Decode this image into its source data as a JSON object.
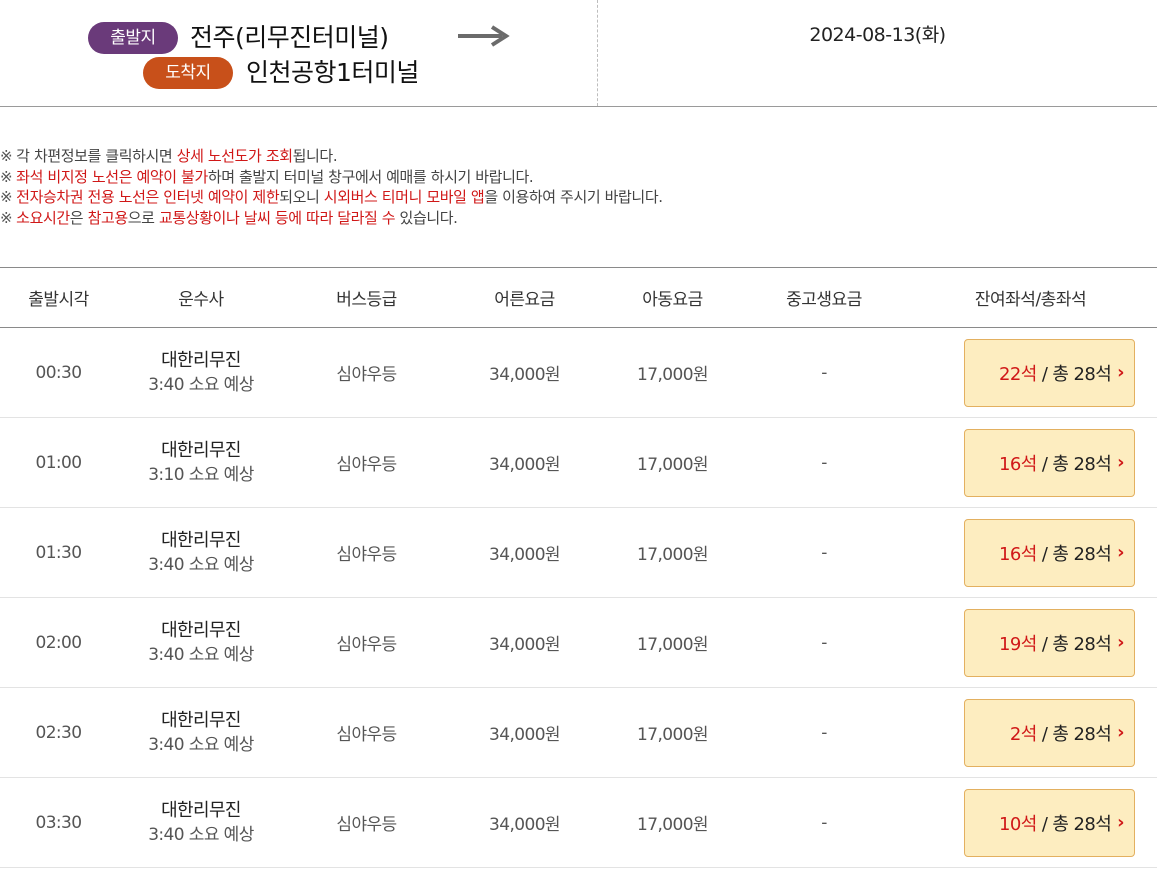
{
  "route": {
    "departure_badge": "출발지",
    "departure_terminal": "전주(리무진터미널)",
    "arrival_badge": "도착지",
    "arrival_terminal": "인천공항1터미널",
    "date": "2024-08-13(화)"
  },
  "notices": [
    [
      {
        "t": "각 차편정보를 클릭하시면 ",
        "hl": false
      },
      {
        "t": "상세 노선도가 조회",
        "hl": true
      },
      {
        "t": "됩니다.",
        "hl": false
      }
    ],
    [
      {
        "t": "좌석 비지정 노선은 예약이 불가",
        "hl": true
      },
      {
        "t": "하며 출발지 터미널 창구에서 예매를 하시기 바랍니다.",
        "hl": false
      }
    ],
    [
      {
        "t": "전자승차권 전용 노선은 인터넷 예약이 제한",
        "hl": true
      },
      {
        "t": "되오니 ",
        "hl": false
      },
      {
        "t": "시외버스 티머니 모바일 앱",
        "hl": true
      },
      {
        "t": "을 이용하여 주시기 바랍니다.",
        "hl": false
      }
    ],
    [
      {
        "t": "소요시간",
        "hl": true
      },
      {
        "t": "은 ",
        "hl": false
      },
      {
        "t": "참고용",
        "hl": true
      },
      {
        "t": "으로 ",
        "hl": false
      },
      {
        "t": "교통상황이나 날씨 등에 따라 달라질 수",
        "hl": true
      },
      {
        "t": " 있습니다.",
        "hl": false
      }
    ]
  ],
  "notice_mark": "※",
  "table": {
    "headers": [
      "출발시각",
      "운수사",
      "버스등급",
      "어른요금",
      "아동요금",
      "중고생요금",
      "잔여좌석/총좌석"
    ],
    "total_prefix": "/ 총",
    "rows": [
      {
        "time": "00:30",
        "company": "대한리무진",
        "duration": "3:40 소요 예상",
        "grade": "심야우등",
        "adult": "34,000원",
        "child": "17,000원",
        "student": "-",
        "remaining": "22석",
        "total": "28석"
      },
      {
        "time": "01:00",
        "company": "대한리무진",
        "duration": "3:10 소요 예상",
        "grade": "심야우등",
        "adult": "34,000원",
        "child": "17,000원",
        "student": "-",
        "remaining": "16석",
        "total": "28석"
      },
      {
        "time": "01:30",
        "company": "대한리무진",
        "duration": "3:40 소요 예상",
        "grade": "심야우등",
        "adult": "34,000원",
        "child": "17,000원",
        "student": "-",
        "remaining": "16석",
        "total": "28석"
      },
      {
        "time": "02:00",
        "company": "대한리무진",
        "duration": "3:40 소요 예상",
        "grade": "심야우등",
        "adult": "34,000원",
        "child": "17,000원",
        "student": "-",
        "remaining": "19석",
        "total": "28석"
      },
      {
        "time": "02:30",
        "company": "대한리무진",
        "duration": "3:40 소요 예상",
        "grade": "심야우등",
        "adult": "34,000원",
        "child": "17,000원",
        "student": "-",
        "remaining": "2석",
        "total": "28석"
      },
      {
        "time": "03:30",
        "company": "대한리무진",
        "duration": "3:40 소요 예상",
        "grade": "심야우등",
        "adult": "34,000원",
        "child": "17,000원",
        "student": "-",
        "remaining": "10석",
        "total": "28석"
      }
    ]
  },
  "colors": {
    "departure_badge": "#6a3a7a",
    "arrival_badge": "#c8501a",
    "highlight": "#d01818",
    "seat_button_bg": "#fdedc0",
    "seat_button_border": "#e3b060"
  },
  "icons": {
    "route_arrow": "right-arrow-icon",
    "seat_chevron": "chevron-right-icon"
  }
}
